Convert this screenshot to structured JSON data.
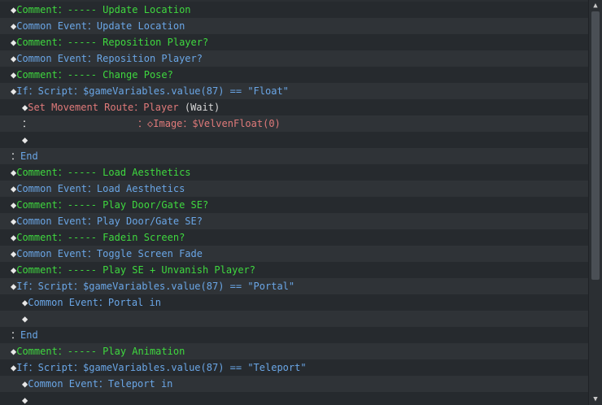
{
  "colors": {
    "background": "#2b2f33",
    "comment": "#3fd83f",
    "common_event": "#6aa6e6",
    "conditional": "#6aa6e6",
    "movement": "#e07a7a",
    "plain": "#d8d8d8"
  },
  "scrollbar": {
    "up_icon": "triangle-up-icon",
    "down_icon": "triangle-down-icon"
  },
  "lines": [
    {
      "indent": 0,
      "marker": "◆",
      "segments": [
        {
          "t": "Comment：----- Update Location",
          "c": "c-comment"
        }
      ]
    },
    {
      "indent": 0,
      "marker": "◆",
      "segments": [
        {
          "t": "Common Event：Update Location",
          "c": "c-common"
        }
      ]
    },
    {
      "indent": 0,
      "marker": "◆",
      "segments": [
        {
          "t": "Comment：----- Reposition Player?",
          "c": "c-comment"
        }
      ]
    },
    {
      "indent": 0,
      "marker": "◆",
      "segments": [
        {
          "t": "Common Event：Reposition Player?",
          "c": "c-common"
        }
      ]
    },
    {
      "indent": 0,
      "marker": "◆",
      "segments": [
        {
          "t": "Comment：----- Change Pose?",
          "c": "c-comment"
        }
      ]
    },
    {
      "indent": 0,
      "marker": "◆",
      "segments": [
        {
          "t": "If：Script：$gameVariables.value(87) == \"Float\"",
          "c": "c-if"
        }
      ]
    },
    {
      "indent": 1,
      "marker": "◆",
      "segments": [
        {
          "t": "Set Movement Route：Player ",
          "c": "c-move"
        },
        {
          "t": "(Wait)",
          "c": "c-plain"
        }
      ]
    },
    {
      "indent": 1,
      "marker": "：",
      "segments": [
        {
          "t": "                  ：◇Image：$VelvenFloat(0)",
          "c": "c-move"
        }
      ]
    },
    {
      "indent": 1,
      "marker": "◆",
      "segments": []
    },
    {
      "indent": 0,
      "marker": "：",
      "segments": [
        {
          "t": "End",
          "c": "c-if"
        }
      ]
    },
    {
      "indent": 0,
      "marker": "◆",
      "segments": [
        {
          "t": "Comment：----- Load Aesthetics",
          "c": "c-comment"
        }
      ]
    },
    {
      "indent": 0,
      "marker": "◆",
      "segments": [
        {
          "t": "Common Event：Load Aesthetics",
          "c": "c-common"
        }
      ]
    },
    {
      "indent": 0,
      "marker": "◆",
      "segments": [
        {
          "t": "Comment：----- Play Door/Gate SE?",
          "c": "c-comment"
        }
      ]
    },
    {
      "indent": 0,
      "marker": "◆",
      "segments": [
        {
          "t": "Common Event：Play Door/Gate SE?",
          "c": "c-common"
        }
      ]
    },
    {
      "indent": 0,
      "marker": "◆",
      "segments": [
        {
          "t": "Comment：----- Fadein Screen?",
          "c": "c-comment"
        }
      ]
    },
    {
      "indent": 0,
      "marker": "◆",
      "segments": [
        {
          "t": "Common Event：Toggle Screen Fade",
          "c": "c-common"
        }
      ]
    },
    {
      "indent": 0,
      "marker": "◆",
      "segments": [
        {
          "t": "Comment：----- Play SE + Unvanish Player?",
          "c": "c-comment"
        }
      ]
    },
    {
      "indent": 0,
      "marker": "◆",
      "segments": [
        {
          "t": "If：Script：$gameVariables.value(87) == \"Portal\"",
          "c": "c-if"
        }
      ]
    },
    {
      "indent": 1,
      "marker": "◆",
      "segments": [
        {
          "t": "Common Event：Portal in",
          "c": "c-common"
        }
      ]
    },
    {
      "indent": 1,
      "marker": "◆",
      "segments": []
    },
    {
      "indent": 0,
      "marker": "：",
      "segments": [
        {
          "t": "End",
          "c": "c-if"
        }
      ]
    },
    {
      "indent": 0,
      "marker": "◆",
      "segments": [
        {
          "t": "Comment：----- Play Animation",
          "c": "c-comment"
        }
      ]
    },
    {
      "indent": 0,
      "marker": "◆",
      "segments": [
        {
          "t": "If：Script：$gameVariables.value(87) == \"Teleport\"",
          "c": "c-if"
        }
      ]
    },
    {
      "indent": 1,
      "marker": "◆",
      "segments": [
        {
          "t": "Common Event：Teleport in",
          "c": "c-common"
        }
      ]
    },
    {
      "indent": 1,
      "marker": "◆",
      "segments": []
    }
  ]
}
